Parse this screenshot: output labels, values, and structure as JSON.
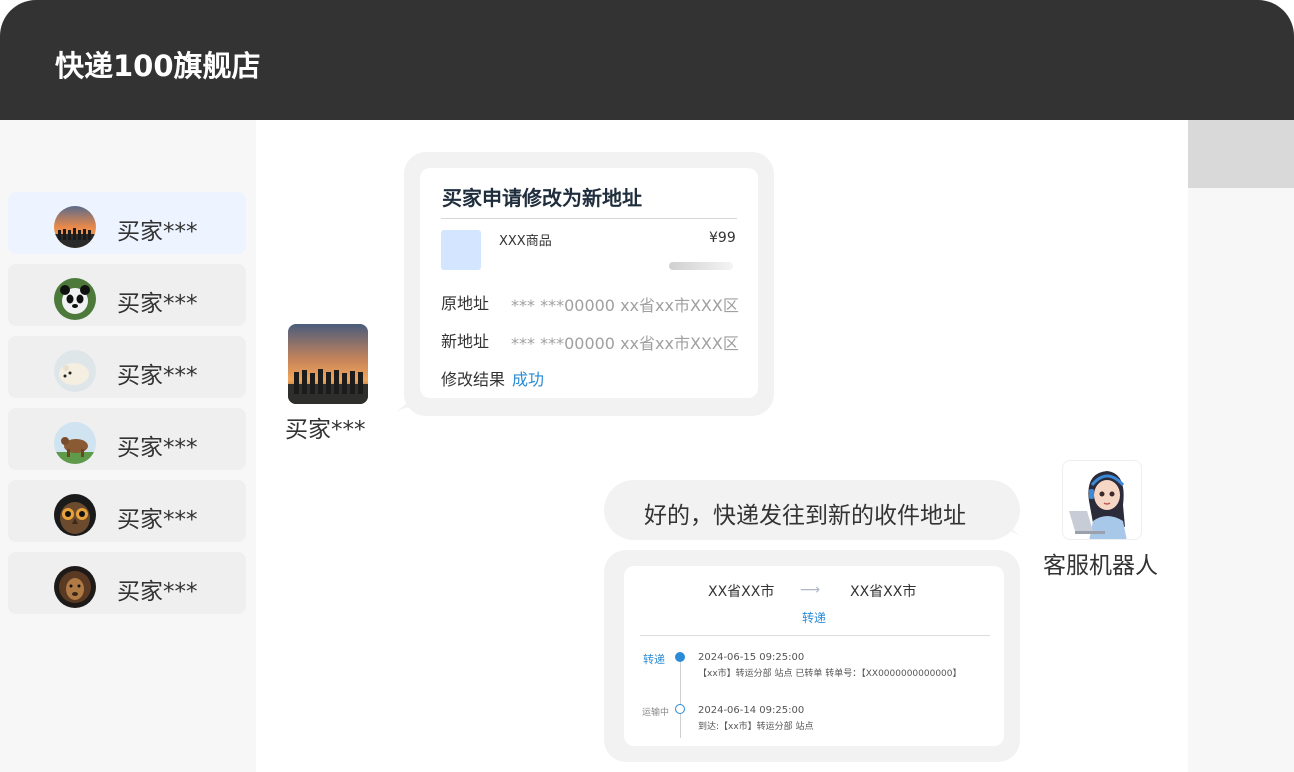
{
  "header": {
    "title": "快递100旗舰店"
  },
  "sidebar": {
    "contacts": [
      {
        "name": "买家***",
        "avatar": "sunset-crowd-avatar-icon",
        "active": true
      },
      {
        "name": "买家***",
        "avatar": "panda-avatar-icon"
      },
      {
        "name": "买家***",
        "avatar": "polar-bear-avatar-icon"
      },
      {
        "name": "买家***",
        "avatar": "yak-avatar-icon"
      },
      {
        "name": "买家***",
        "avatar": "owl-avatar-icon"
      },
      {
        "name": "买家***",
        "avatar": "lion-avatar-icon"
      }
    ]
  },
  "chat": {
    "buyer": {
      "name": "买家***"
    },
    "agent": {
      "name": "客服机器人"
    },
    "address_card": {
      "title": "买家申请修改为新地址",
      "product_name": "XXX商品",
      "price": "¥99",
      "old_address_label": "原地址",
      "old_address_value": "*** ***00000 xx省xx市XXX区",
      "new_address_label": "新地址",
      "new_address_value": "*** ***00000 xx省xx市XXX区",
      "result_label": "修改结果",
      "result_value": "成功"
    },
    "reply_text": "好的，快递发往到新的收件地址",
    "tracking_card": {
      "from": "XX省XX市",
      "to": "XX省XX市",
      "mode": "转递",
      "events": [
        {
          "status": "转递",
          "time": "2024-06-15 09:25:00",
          "desc": "【xx市】转运分部 站点 已转单 转单号：【XX0000000000000】"
        },
        {
          "status": "运输中",
          "time": "2024-06-14 09:25:00",
          "desc": "到达:【xx市】转运分部 站点"
        }
      ]
    }
  },
  "colors": {
    "titlebar": "#333333",
    "accent_blue": "#2a8bd6",
    "bubble_gray": "#f2f2f2",
    "active_contact": "#edf4ff"
  }
}
